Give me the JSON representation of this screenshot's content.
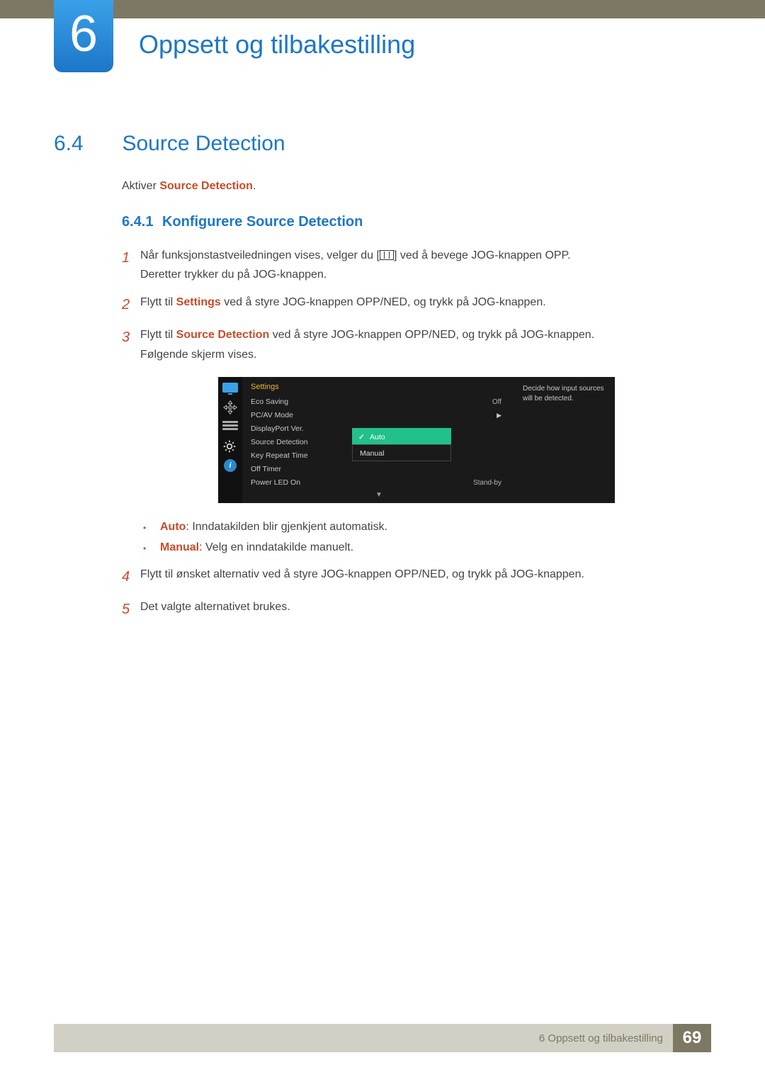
{
  "chapter": {
    "number": "6",
    "title": "Oppsett og tilbakestilling"
  },
  "section": {
    "number": "6.4",
    "title": "Source Detection"
  },
  "intro": {
    "prefix": "Aktiver ",
    "term": "Source Detection",
    "suffix": "."
  },
  "subsection": {
    "number": "6.4.1",
    "title": "Konfigurere Source Detection"
  },
  "step1": {
    "p1a": "Når funksjonstastveiledningen vises, velger du [",
    "p1b": "] ved å bevege JOG-knappen OPP.",
    "p2": "Deretter trykker du på JOG-knappen."
  },
  "step2": {
    "a": "Flytt til ",
    "term": "Settings",
    "b": " ved å styre JOG-knappen OPP/NED, og trykk på JOG-knappen."
  },
  "step3": {
    "a": "Flytt til ",
    "term": "Source Detection",
    "b": " ved å styre JOG-knappen OPP/NED, og trykk på JOG-knappen.",
    "p2": "Følgende skjerm vises."
  },
  "osd": {
    "heading": "Settings",
    "items": {
      "eco": {
        "label": "Eco Saving",
        "value": "Off"
      },
      "pcav": {
        "label": "PC/AV Mode",
        "value": ""
      },
      "dp": {
        "label": "DisplayPort Ver.",
        "value": ""
      },
      "src": {
        "label": "Source Detection",
        "value": ""
      },
      "key": {
        "label": "Key Repeat Time",
        "value": ""
      },
      "timer": {
        "label": "Off Timer",
        "value": ""
      },
      "led": {
        "label": "Power LED On",
        "value": "Stand-by"
      }
    },
    "options": {
      "auto": "Auto",
      "manual": "Manual"
    },
    "desc": "Decide how input sources will be detected."
  },
  "bulletAuto": {
    "term": "Auto",
    "text": ": Inndatakilden blir gjenkjent automatisk."
  },
  "bulletManual": {
    "term": "Manual",
    "text": ": Velg en inndatakilde manuelt."
  },
  "step4": "Flytt til ønsket alternativ ved å styre JOG-knappen OPP/NED, og trykk på JOG-knappen.",
  "step5": "Det valgte alternativet brukes.",
  "footer": {
    "text": "6 Oppsett og tilbakestilling",
    "page": "69"
  }
}
